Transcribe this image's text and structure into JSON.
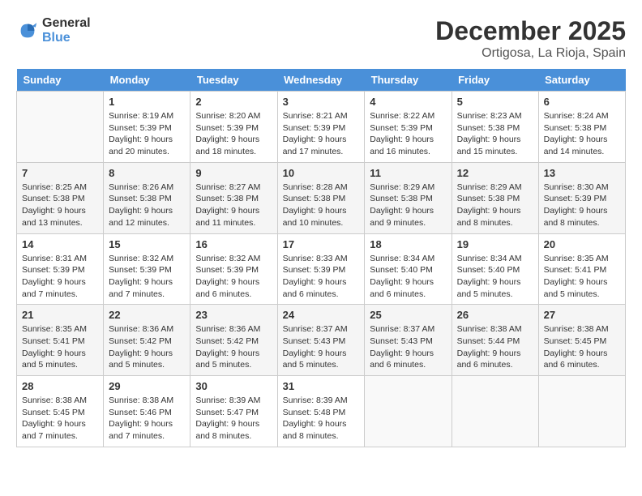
{
  "header": {
    "logo_line1": "General",
    "logo_line2": "Blue",
    "title": "December 2025",
    "subtitle": "Ortigosa, La Rioja, Spain"
  },
  "weekdays": [
    "Sunday",
    "Monday",
    "Tuesday",
    "Wednesday",
    "Thursday",
    "Friday",
    "Saturday"
  ],
  "weeks": [
    [
      {
        "day": "",
        "info": ""
      },
      {
        "day": "1",
        "info": "Sunrise: 8:19 AM\nSunset: 5:39 PM\nDaylight: 9 hours\nand 20 minutes."
      },
      {
        "day": "2",
        "info": "Sunrise: 8:20 AM\nSunset: 5:39 PM\nDaylight: 9 hours\nand 18 minutes."
      },
      {
        "day": "3",
        "info": "Sunrise: 8:21 AM\nSunset: 5:39 PM\nDaylight: 9 hours\nand 17 minutes."
      },
      {
        "day": "4",
        "info": "Sunrise: 8:22 AM\nSunset: 5:39 PM\nDaylight: 9 hours\nand 16 minutes."
      },
      {
        "day": "5",
        "info": "Sunrise: 8:23 AM\nSunset: 5:38 PM\nDaylight: 9 hours\nand 15 minutes."
      },
      {
        "day": "6",
        "info": "Sunrise: 8:24 AM\nSunset: 5:38 PM\nDaylight: 9 hours\nand 14 minutes."
      }
    ],
    [
      {
        "day": "7",
        "info": "Sunrise: 8:25 AM\nSunset: 5:38 PM\nDaylight: 9 hours\nand 13 minutes."
      },
      {
        "day": "8",
        "info": "Sunrise: 8:26 AM\nSunset: 5:38 PM\nDaylight: 9 hours\nand 12 minutes."
      },
      {
        "day": "9",
        "info": "Sunrise: 8:27 AM\nSunset: 5:38 PM\nDaylight: 9 hours\nand 11 minutes."
      },
      {
        "day": "10",
        "info": "Sunrise: 8:28 AM\nSunset: 5:38 PM\nDaylight: 9 hours\nand 10 minutes."
      },
      {
        "day": "11",
        "info": "Sunrise: 8:29 AM\nSunset: 5:38 PM\nDaylight: 9 hours\nand 9 minutes."
      },
      {
        "day": "12",
        "info": "Sunrise: 8:29 AM\nSunset: 5:38 PM\nDaylight: 9 hours\nand 8 minutes."
      },
      {
        "day": "13",
        "info": "Sunrise: 8:30 AM\nSunset: 5:39 PM\nDaylight: 9 hours\nand 8 minutes."
      }
    ],
    [
      {
        "day": "14",
        "info": "Sunrise: 8:31 AM\nSunset: 5:39 PM\nDaylight: 9 hours\nand 7 minutes."
      },
      {
        "day": "15",
        "info": "Sunrise: 8:32 AM\nSunset: 5:39 PM\nDaylight: 9 hours\nand 7 minutes."
      },
      {
        "day": "16",
        "info": "Sunrise: 8:32 AM\nSunset: 5:39 PM\nDaylight: 9 hours\nand 6 minutes."
      },
      {
        "day": "17",
        "info": "Sunrise: 8:33 AM\nSunset: 5:39 PM\nDaylight: 9 hours\nand 6 minutes."
      },
      {
        "day": "18",
        "info": "Sunrise: 8:34 AM\nSunset: 5:40 PM\nDaylight: 9 hours\nand 6 minutes."
      },
      {
        "day": "19",
        "info": "Sunrise: 8:34 AM\nSunset: 5:40 PM\nDaylight: 9 hours\nand 5 minutes."
      },
      {
        "day": "20",
        "info": "Sunrise: 8:35 AM\nSunset: 5:41 PM\nDaylight: 9 hours\nand 5 minutes."
      }
    ],
    [
      {
        "day": "21",
        "info": "Sunrise: 8:35 AM\nSunset: 5:41 PM\nDaylight: 9 hours\nand 5 minutes."
      },
      {
        "day": "22",
        "info": "Sunrise: 8:36 AM\nSunset: 5:42 PM\nDaylight: 9 hours\nand 5 minutes."
      },
      {
        "day": "23",
        "info": "Sunrise: 8:36 AM\nSunset: 5:42 PM\nDaylight: 9 hours\nand 5 minutes."
      },
      {
        "day": "24",
        "info": "Sunrise: 8:37 AM\nSunset: 5:43 PM\nDaylight: 9 hours\nand 5 minutes."
      },
      {
        "day": "25",
        "info": "Sunrise: 8:37 AM\nSunset: 5:43 PM\nDaylight: 9 hours\nand 6 minutes."
      },
      {
        "day": "26",
        "info": "Sunrise: 8:38 AM\nSunset: 5:44 PM\nDaylight: 9 hours\nand 6 minutes."
      },
      {
        "day": "27",
        "info": "Sunrise: 8:38 AM\nSunset: 5:45 PM\nDaylight: 9 hours\nand 6 minutes."
      }
    ],
    [
      {
        "day": "28",
        "info": "Sunrise: 8:38 AM\nSunset: 5:45 PM\nDaylight: 9 hours\nand 7 minutes."
      },
      {
        "day": "29",
        "info": "Sunrise: 8:38 AM\nSunset: 5:46 PM\nDaylight: 9 hours\nand 7 minutes."
      },
      {
        "day": "30",
        "info": "Sunrise: 8:39 AM\nSunset: 5:47 PM\nDaylight: 9 hours\nand 8 minutes."
      },
      {
        "day": "31",
        "info": "Sunrise: 8:39 AM\nSunset: 5:48 PM\nDaylight: 9 hours\nand 8 minutes."
      },
      {
        "day": "",
        "info": ""
      },
      {
        "day": "",
        "info": ""
      },
      {
        "day": "",
        "info": ""
      }
    ]
  ]
}
